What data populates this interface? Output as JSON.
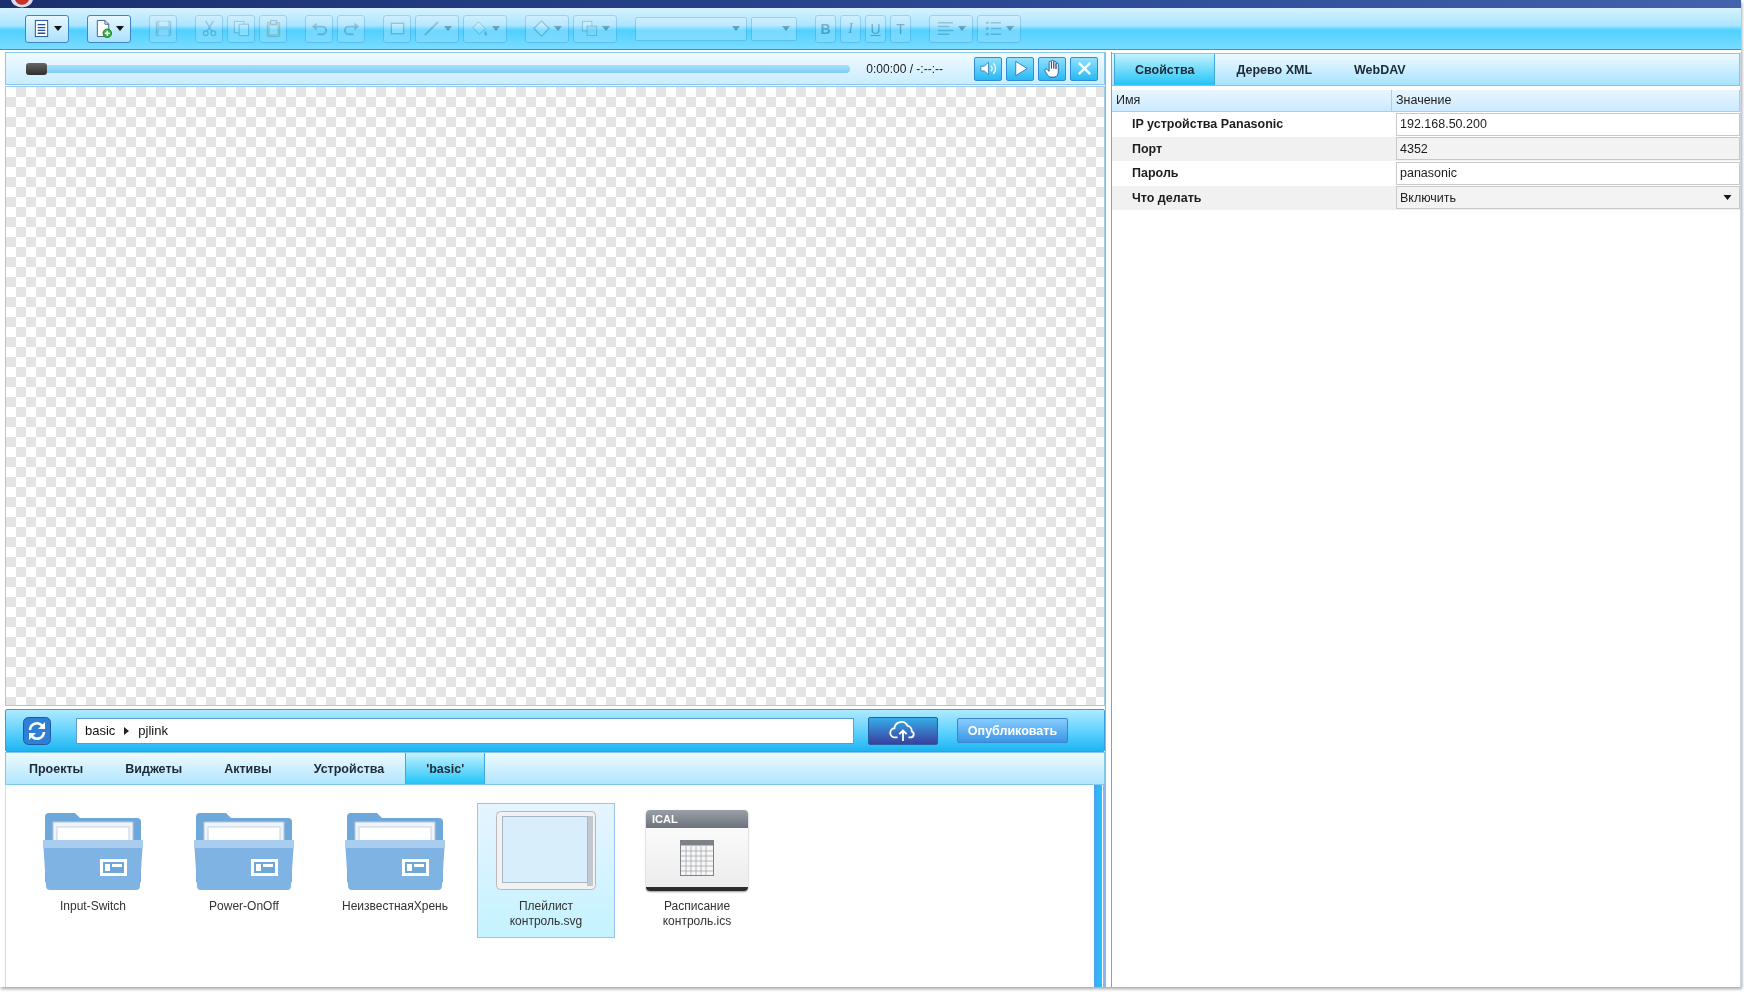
{
  "toolbar": {
    "groups": [
      {
        "items": [
          {
            "kind": "menu",
            "dropdown": true,
            "disabled": false
          }
        ]
      },
      {
        "items": [
          {
            "kind": "new",
            "dropdown": true,
            "disabled": false
          }
        ]
      },
      {
        "items": [
          {
            "kind": "save",
            "dropdown": false,
            "disabled": true
          }
        ]
      },
      {
        "items": [
          {
            "kind": "cut",
            "dropdown": false,
            "disabled": true
          },
          {
            "kind": "copy",
            "dropdown": false,
            "disabled": true
          },
          {
            "kind": "paste",
            "dropdown": false,
            "disabled": true
          }
        ]
      },
      {
        "items": [
          {
            "kind": "undo",
            "dropdown": false,
            "disabled": true
          },
          {
            "kind": "redo",
            "dropdown": false,
            "disabled": true
          }
        ]
      },
      {
        "items": [
          {
            "kind": "rect",
            "dropdown": false,
            "disabled": true
          },
          {
            "kind": "line",
            "dropdown": true,
            "disabled": true
          },
          {
            "kind": "fill",
            "dropdown": true,
            "disabled": true
          }
        ]
      },
      {
        "items": [
          {
            "kind": "shape",
            "dropdown": true,
            "disabled": true
          },
          {
            "kind": "arrange",
            "dropdown": true,
            "disabled": true
          }
        ]
      },
      {
        "items": [
          {
            "kind": "fontfamily",
            "dropdown": true,
            "disabled": true
          },
          {
            "kind": "fontsize",
            "dropdown": true,
            "disabled": true
          }
        ]
      },
      {
        "items": [
          {
            "kind": "bold",
            "label": "B",
            "dropdown": false,
            "disabled": true
          },
          {
            "kind": "italic",
            "label": "I",
            "dropdown": false,
            "disabled": true
          },
          {
            "kind": "underline",
            "label": "U",
            "dropdown": false,
            "disabled": true
          },
          {
            "kind": "text",
            "label": "T",
            "dropdown": false,
            "disabled": true
          }
        ]
      },
      {
        "items": [
          {
            "kind": "align",
            "dropdown": true,
            "disabled": true
          },
          {
            "kind": "list",
            "dropdown": true,
            "disabled": true
          }
        ]
      }
    ]
  },
  "player": {
    "seek": {
      "level": 0
    },
    "time": "0:00:00 / -:--:--",
    "buttons": [
      {
        "kind": "volume"
      },
      {
        "kind": "play"
      },
      {
        "kind": "hand"
      },
      {
        "kind": "close"
      }
    ]
  },
  "path_bar": {
    "breadcrumb": [
      "basic",
      "pjlink"
    ],
    "publish_button": "Опубликовать"
  },
  "file_browser": {
    "tabs": [
      {
        "label": "Проекты",
        "selected": false
      },
      {
        "label": "Виджеты",
        "selected": false
      },
      {
        "label": "Активы",
        "selected": false
      },
      {
        "label": "Устройства",
        "selected": false
      },
      {
        "label": "'basic'",
        "selected": true
      }
    ],
    "items": [
      {
        "kind": "folder",
        "name": "Input-Switch",
        "selected": false
      },
      {
        "kind": "folder",
        "name": "Power-OnOff",
        "selected": false
      },
      {
        "kind": "folder",
        "name": "НеизвестнаяХрень",
        "selected": false
      },
      {
        "kind": "svg",
        "name": "Плейлист контроль.svg",
        "selected": true
      },
      {
        "kind": "ical",
        "name": "Расписание контроль.ics",
        "badge": "ICAL",
        "selected": false
      }
    ]
  },
  "properties_panel": {
    "tabs": [
      {
        "label": "Свойства",
        "selected": true
      },
      {
        "label": "Дерево XML",
        "selected": false
      },
      {
        "label": "WebDAV",
        "selected": false
      }
    ],
    "table": {
      "columns": [
        "Имя",
        "Значение"
      ],
      "rows": [
        {
          "name": "IP устройства Panasonic",
          "value": "192.168.50.200",
          "kind": "text"
        },
        {
          "name": "Порт",
          "value": "4352",
          "kind": "text"
        },
        {
          "name": "Пароль",
          "value": "panasonic",
          "kind": "text"
        },
        {
          "name": "Что делать",
          "value": "Включить",
          "kind": "select"
        }
      ]
    }
  }
}
